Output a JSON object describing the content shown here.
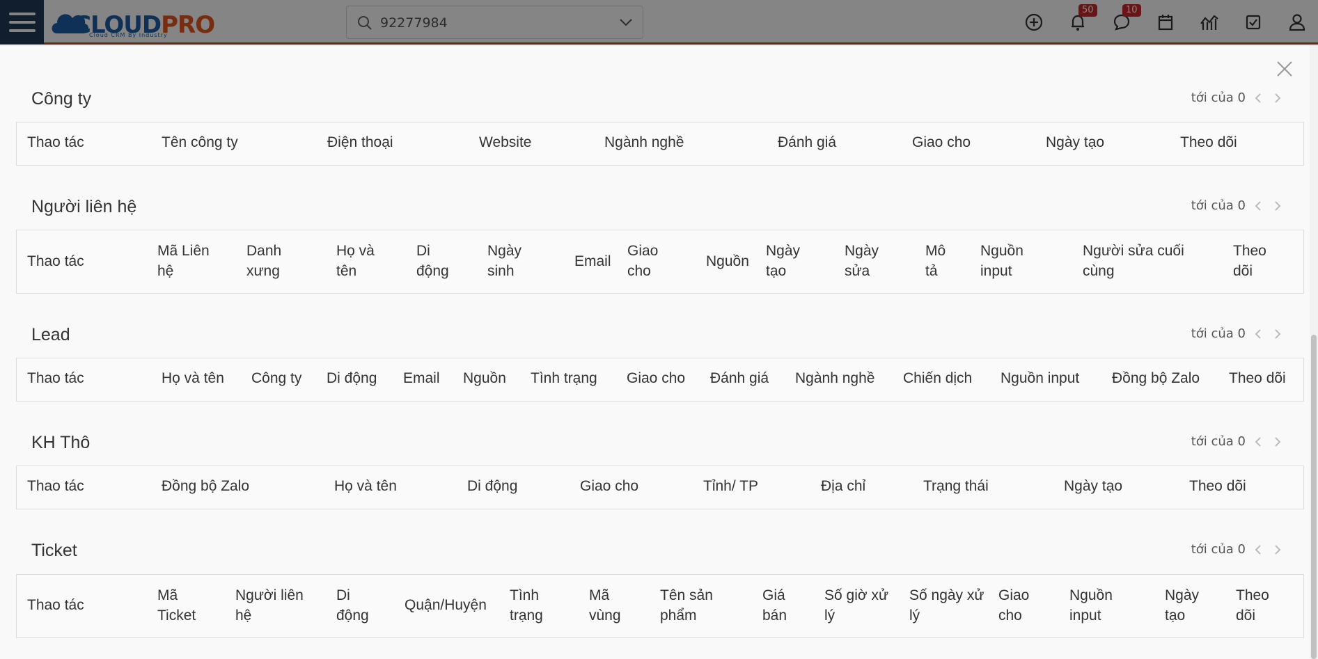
{
  "search": {
    "value": "92277984"
  },
  "notifications": {
    "bell_count": "50",
    "chat_count": "10"
  },
  "logo": {
    "text_cloud": "CLOUD",
    "text_pro": "PRO",
    "tagline": "Cloud CRM By Industry"
  },
  "sections": [
    {
      "title": "Công ty",
      "pager": "tới của 0",
      "columns": [
        "Thao tác",
        "Tên công ty",
        "Điện thoại",
        "Website",
        "Ngành nghề",
        "Đánh giá",
        "Giao cho",
        "Ngày tạo",
        "Theo dõi"
      ]
    },
    {
      "title": "Người liên hệ",
      "pager": "tới của 0",
      "columns": [
        "Thao tác",
        "Mã Liên hệ",
        "Danh xưng",
        "Họ và tên",
        "Di động",
        "Ngày sinh",
        "Email",
        "Giao cho",
        "Nguồn",
        "Ngày tạo",
        "Ngày sửa",
        "Mô tả",
        "Nguồn input",
        "Người sửa cuối cùng",
        "Theo dõi"
      ]
    },
    {
      "title": "Lead",
      "pager": "tới của 0",
      "columns": [
        "Thao tác",
        "Họ và tên",
        "Công ty",
        "Di động",
        "Email",
        "Nguồn",
        "Tình trạng",
        "Giao cho",
        "Đánh giá",
        "Ngành nghề",
        "Chiến dịch",
        "Nguồn input",
        "Đồng bộ Zalo",
        "Theo dõi"
      ]
    },
    {
      "title": "KH Thô",
      "pager": "tới của 0",
      "columns": [
        "Thao tác",
        "Đồng bộ Zalo",
        "Họ và tên",
        "Di động",
        "Giao cho",
        "Tỉnh/ TP",
        "Địa chỉ",
        "Trạng thái",
        "Ngày tạo",
        "Theo dõi"
      ]
    },
    {
      "title": "Ticket",
      "pager": "tới của 0",
      "columns": [
        "Thao tác",
        "Mã Ticket",
        "Người liên hệ",
        "Di động",
        "Quận/Huyện",
        "Tình trạng",
        "Mã vùng",
        "Tên sản phẩm",
        "Giá bán",
        "Số giờ xử lý",
        "Số ngày xử lý",
        "Giao cho",
        "Nguồn input",
        "Ngày tạo",
        "Theo dõi"
      ]
    }
  ]
}
